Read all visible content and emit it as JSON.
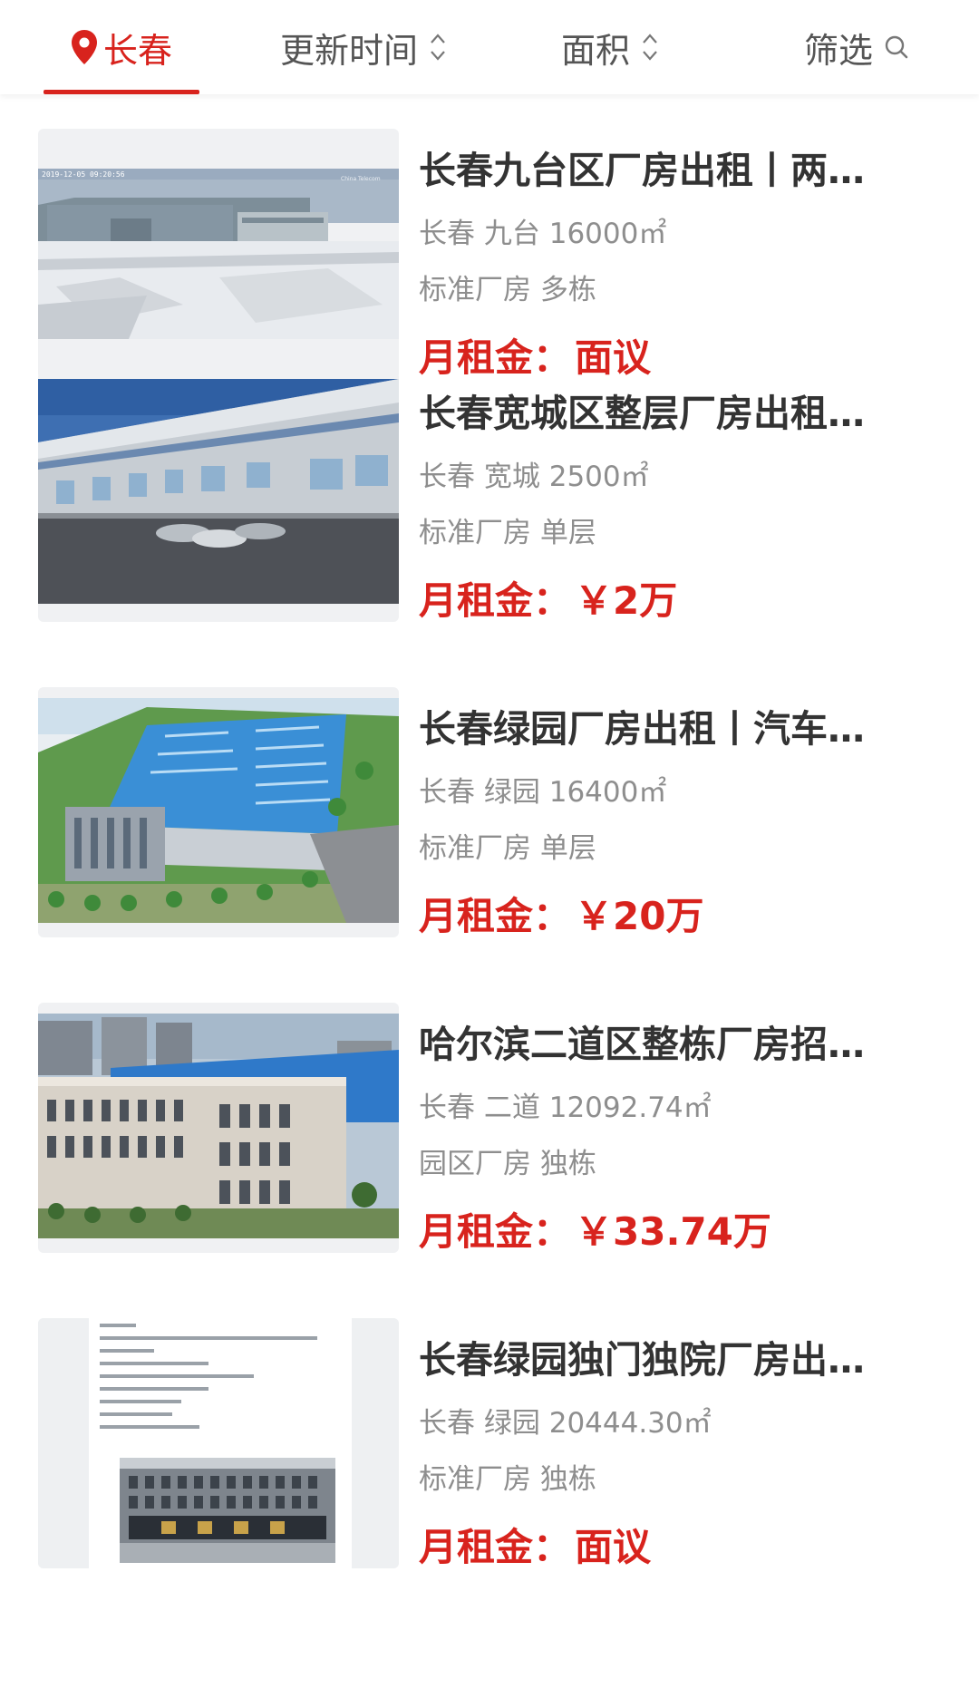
{
  "filter_bar": {
    "city": "长春",
    "sort_update_time": "更新时间",
    "sort_area": "面积",
    "filter": "筛选",
    "accent_color": "#d8231d"
  },
  "listings": [
    {
      "title": "长春九台区厂房出租丨两…",
      "city": "长春",
      "district": "九台",
      "area": "16000㎡",
      "type": "标准厂房",
      "layout": "多栋",
      "price_label": "月租金：",
      "price": "面议",
      "image_desc": "snowy-field-factory",
      "image_stamp": "2019-12-05 09:20:56",
      "image_watermark": "China Telecom"
    },
    {
      "title": "长春宽城区整层厂房出租…",
      "city": "长春",
      "district": "宽城",
      "area": "2500㎡",
      "type": "标准厂房",
      "layout": "单层",
      "price_label": "月租金：",
      "price": "￥2万",
      "image_desc": "long-warehouse-building"
    },
    {
      "title": "长春绿园厂房出租丨汽车…",
      "city": "长春",
      "district": "绿园",
      "area": "16400㎡",
      "type": "标准厂房",
      "layout": "单层",
      "price_label": "月租金：",
      "price": "￥20万",
      "image_desc": "blue-roof-factory-render"
    },
    {
      "title": "哈尔滨二道区整栋厂房招…",
      "city": "长春",
      "district": "二道",
      "area": "12092.74㎡",
      "type": "园区厂房",
      "layout": "独栋",
      "price_label": "月租金：",
      "price": "￥33.74万",
      "image_desc": "multi-story-factory-building"
    },
    {
      "title": "长春绿园独门独院厂房出…",
      "city": "长春",
      "district": "绿园",
      "area": "20444.30㎡",
      "type": "标准厂房",
      "layout": "独栋",
      "price_label": "月租金：",
      "price": "面议",
      "image_desc": "document-with-building-photo"
    }
  ]
}
